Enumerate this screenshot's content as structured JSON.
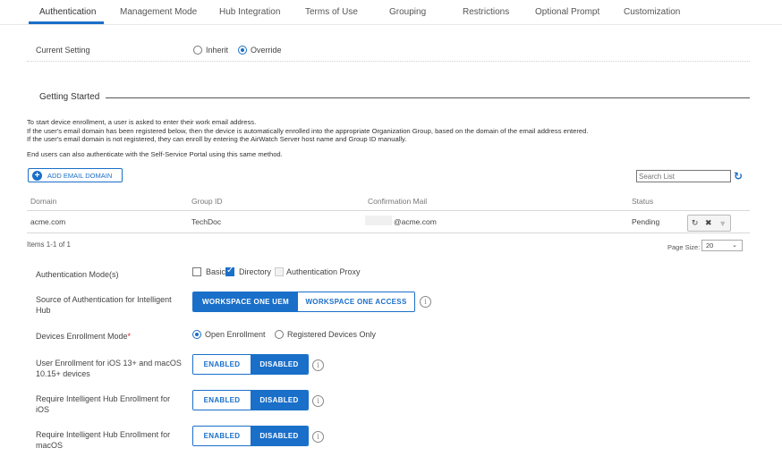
{
  "tabs": [
    {
      "label": "Authentication",
      "active": true
    },
    {
      "label": "Management Mode"
    },
    {
      "label": "Hub Integration"
    },
    {
      "label": "Terms of Use"
    },
    {
      "label": "Grouping"
    },
    {
      "label": "Restrictions"
    },
    {
      "label": "Optional Prompt"
    },
    {
      "label": "Customization"
    }
  ],
  "current_setting": {
    "label": "Current Setting",
    "options": [
      "Inherit",
      "Override"
    ],
    "selected": "Override"
  },
  "getting_started": {
    "title": "Getting Started",
    "lines": [
      "To start device enrollment, a user is asked to enter their work email address.",
      "If the user's email domain has been registered below, then the device is automatically enrolled into the appropriate Organization Group, based on the domain of the email address entered.",
      "If the user's email domain is not registered, they can enroll by entering the AirWatch Server host name and Group ID manually.",
      "End users can also authenticate with the Self-Service Portal using this same method."
    ]
  },
  "toolbar": {
    "add_label": "ADD EMAIL DOMAIN",
    "search_placeholder": "Search List"
  },
  "grid": {
    "columns": [
      "Domain",
      "Group ID",
      "Confirmation Mail",
      "Status"
    ],
    "rows": [
      {
        "domain": "acme.com",
        "group_id": "TechDoc",
        "mail": "@acme.com",
        "status": "Pending"
      }
    ],
    "items_label": "Items 1-1 of 1",
    "page_size_label": "Page Size:",
    "page_size": "20"
  },
  "auth_modes": {
    "label": "Authentication Mode(s)",
    "options": [
      {
        "label": "Basic",
        "checked": false
      },
      {
        "label": "Directory",
        "checked": true
      },
      {
        "label": "Authentication Proxy",
        "checked": false,
        "disabled": true
      }
    ]
  },
  "source_auth": {
    "label_line1": "Source of Authentication for Intelligent",
    "label_line2": "Hub",
    "options": [
      "WORKSPACE ONE UEM",
      "WORKSPACE ONE ACCESS"
    ],
    "selected": "WORKSPACE ONE UEM"
  },
  "enrollment_mode": {
    "label": "Devices Enrollment Mode",
    "required_mark": "*",
    "options": [
      "Open Enrollment",
      "Registered Devices Only"
    ],
    "selected": "Open Enrollment"
  },
  "user_enrollment": {
    "label_line1": "User Enrollment for iOS 13+ and macOS",
    "label_line2": "10.15+ devices",
    "options": [
      "ENABLED",
      "DISABLED"
    ],
    "selected": "DISABLED"
  },
  "hub_ios": {
    "label_line1": "Require Intelligent Hub Enrollment for",
    "label_line2": "iOS",
    "options": [
      "ENABLED",
      "DISABLED"
    ],
    "selected": "DISABLED"
  },
  "hub_macos": {
    "label_line1": "Require Intelligent Hub Enrollment for",
    "label_line2": "macOS",
    "options": [
      "ENABLED",
      "DISABLED"
    ],
    "selected": "DISABLED"
  },
  "colors": {
    "accent": "#1a6fc9",
    "required": "#dd2222"
  }
}
